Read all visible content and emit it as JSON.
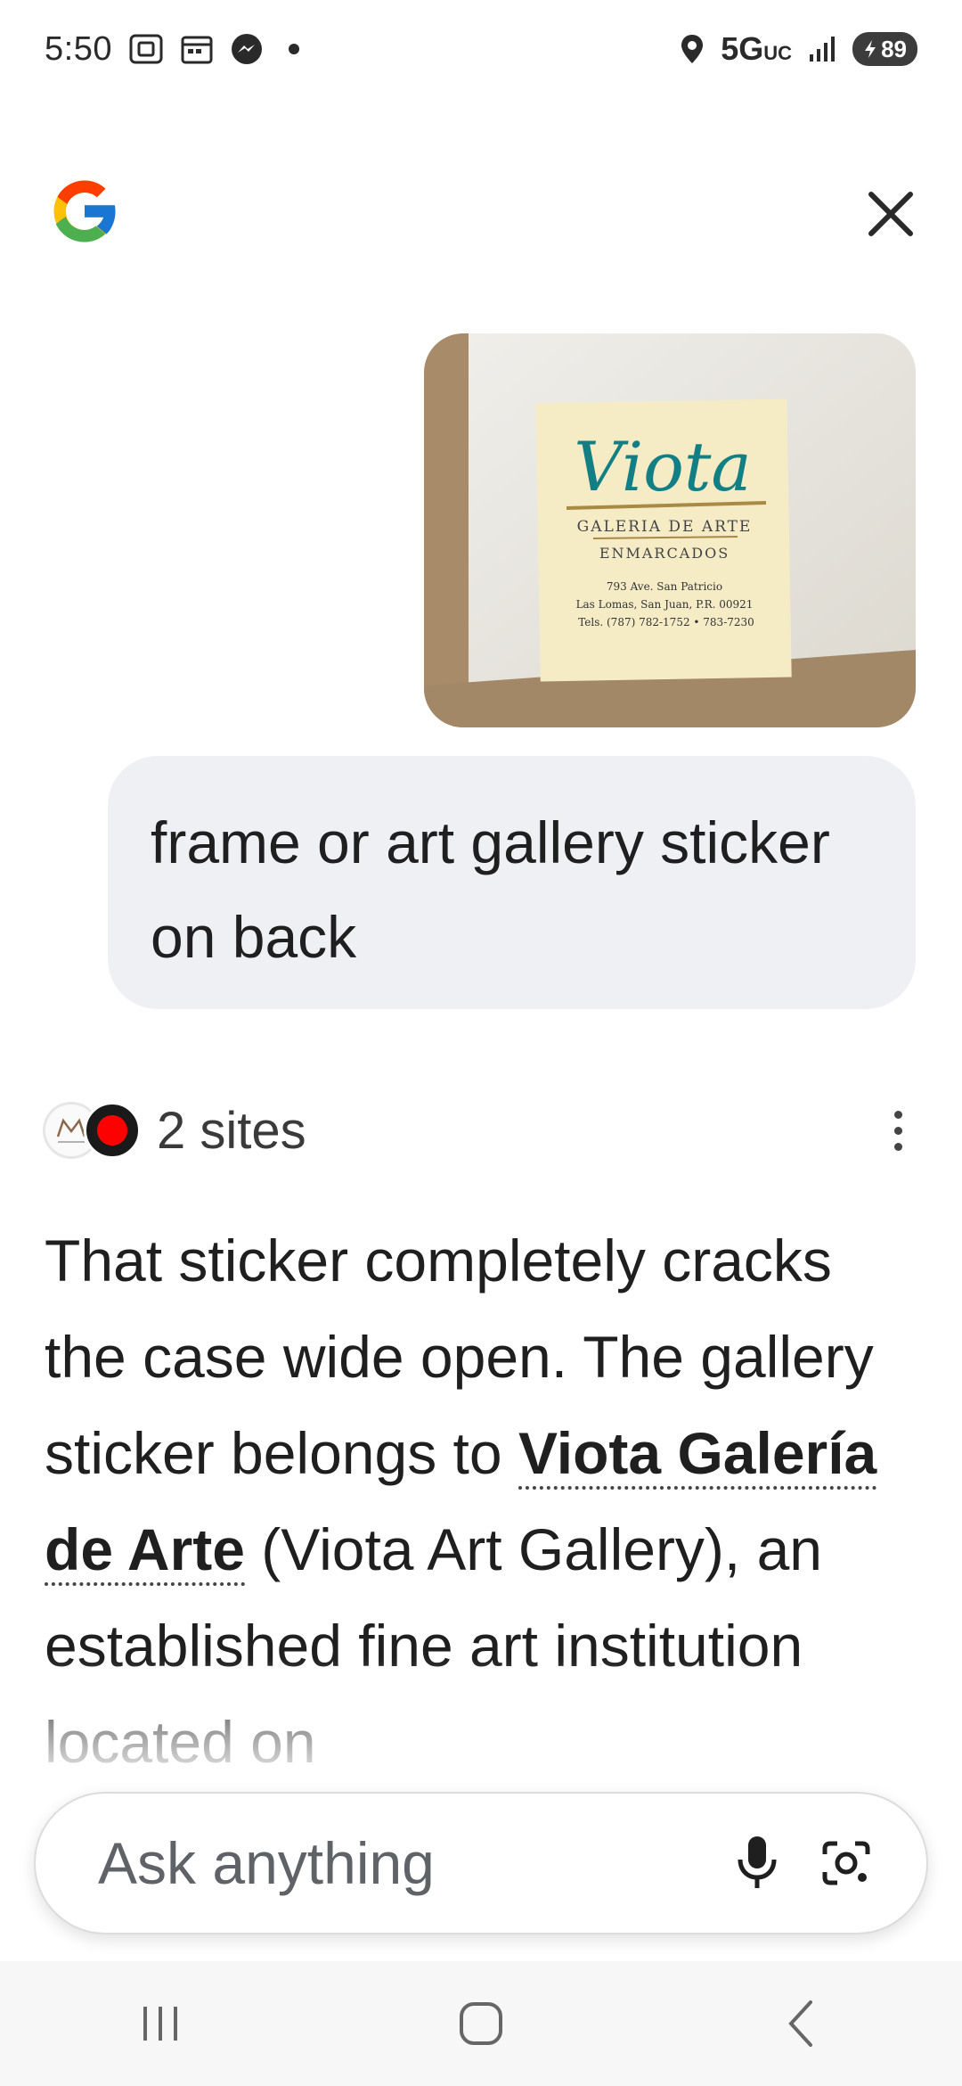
{
  "status_bar": {
    "time": "5:50",
    "network": "5G",
    "network_sub": "UC",
    "battery": "89"
  },
  "header": {
    "logo_icon": "google-g-icon",
    "close_icon": "close-icon"
  },
  "user_image": {
    "sticker_brand": "Viota",
    "sticker_line1": "GALERIA DE ARTE",
    "sticker_line2": "ENMARCADOS",
    "sticker_address1": "793 Ave. San Patricio",
    "sticker_address2": "Las Lomas, San Juan, P.R. 00921",
    "sticker_phone": "Tels. (787) 782-1752 • 783-7230"
  },
  "query": {
    "text": "frame or art gallery sticker on back"
  },
  "sources": {
    "label": "2 sites"
  },
  "answer": {
    "part1": "That sticker completely cracks the case wide open. The gallery sticker belongs to ",
    "highlight": "Viota Galería de Arte",
    "part2": " (Viota Art Gallery), an established fine art institution located on"
  },
  "ask_bar": {
    "placeholder": "Ask anything"
  }
}
